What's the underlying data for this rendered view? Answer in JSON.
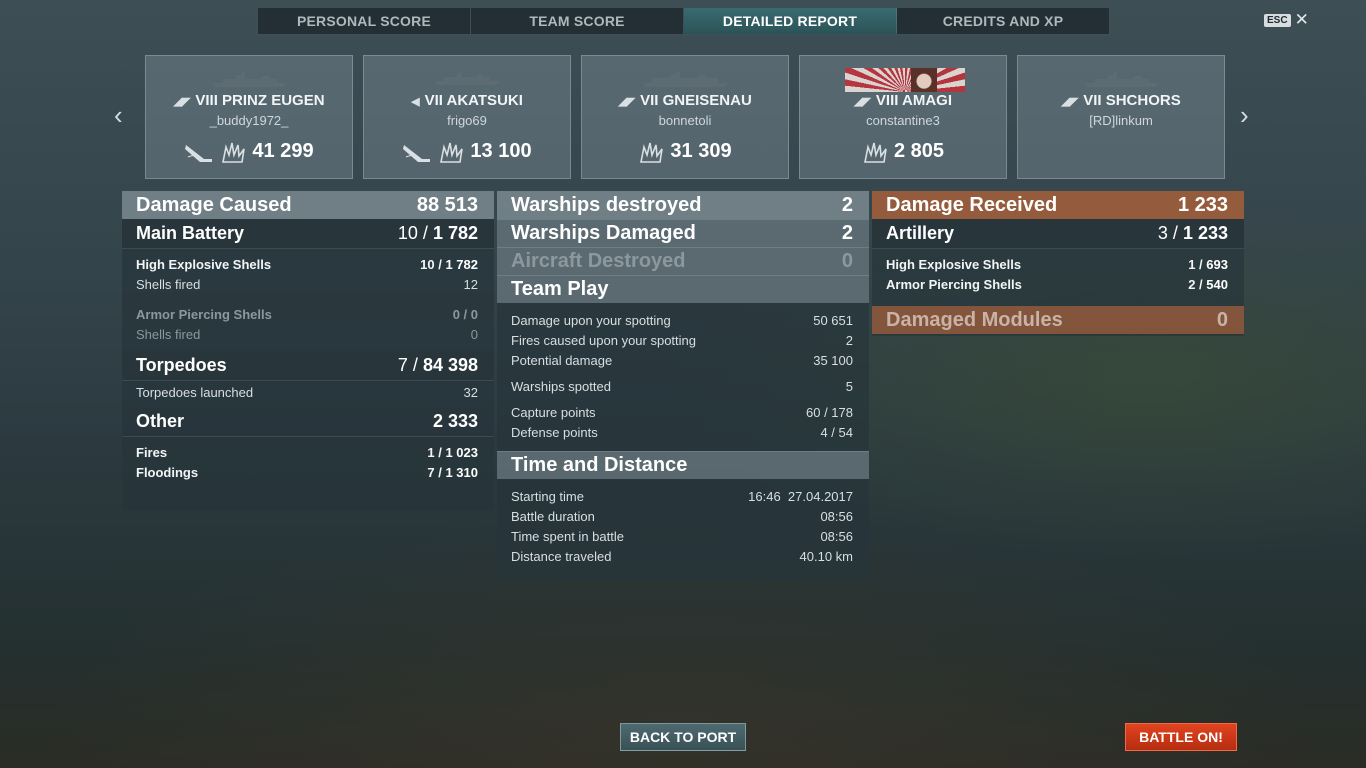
{
  "tabs": [
    "PERSONAL SCORE",
    "TEAM SCORE",
    "DETAILED REPORT",
    "CREDITS AND XP"
  ],
  "esc": {
    "key": "ESC",
    "close": "✕"
  },
  "nav": {
    "prev": "‹",
    "next": "›"
  },
  "cards": [
    {
      "cls": "◢◤",
      "name": "VIII PRINZ EUGEN",
      "player": "_buddy1972_",
      "score": "41 299"
    },
    {
      "cls": "◀",
      "name": "VII AKATSUKI",
      "player": "frigo69",
      "score": "13 100"
    },
    {
      "cls": "◢◤",
      "name": "VII GNEISENAU",
      "player": "bonnetoli",
      "score": "31 309"
    },
    {
      "cls": "◢◤",
      "name": "VIII AMAGI",
      "player": "constantine3",
      "score": "2 805"
    },
    {
      "cls": "◢◤",
      "name": "VII SHCHORS",
      "player": "[RD]linkum",
      "score": ""
    }
  ],
  "left": {
    "damage_caused": {
      "label": "Damage Caused",
      "value": "88 513"
    },
    "main_battery": {
      "label": "Main Battery",
      "hits": "10 /",
      "dmg": "1 782"
    },
    "he": {
      "label": "High Explosive Shells",
      "hits": "10 /",
      "dmg": "1 782"
    },
    "he_fired": {
      "label": "Shells fired",
      "value": "12"
    },
    "ap": {
      "label": "Armor Piercing Shells",
      "value": "0 / 0"
    },
    "ap_fired": {
      "label": "Shells fired",
      "value": "0"
    },
    "torpedoes": {
      "label": "Torpedoes",
      "hits": "7 /",
      "dmg": "84 398"
    },
    "torp_launched": {
      "label": "Torpedoes launched",
      "value": "32"
    },
    "other": {
      "label": "Other",
      "value": "2 333"
    },
    "fires": {
      "label": "Fires",
      "hits": "1 /",
      "dmg": "1 023"
    },
    "floodings": {
      "label": "Floodings",
      "hits": "7 /",
      "dmg": "1 310"
    }
  },
  "middle": {
    "destroyed": {
      "label": "Warships destroyed",
      "value": "2"
    },
    "damaged": {
      "label": "Warships Damaged",
      "value": "2"
    },
    "aircraft": {
      "label": "Aircraft Destroyed",
      "value": "0"
    },
    "team_play": "Team Play",
    "spot_dmg": {
      "label": "Damage upon your spotting",
      "value": "50 651"
    },
    "spot_fires": {
      "label": "Fires caused upon your spotting",
      "value": "2"
    },
    "potential": {
      "label": "Potential damage",
      "value": "35 100"
    },
    "spotted": {
      "label": "Warships spotted",
      "value": "5"
    },
    "capture": {
      "label": "Capture points",
      "value": "60 / 178"
    },
    "defense": {
      "label": "Defense points",
      "value": "4 / 54"
    },
    "time_distance": "Time and Distance",
    "start": {
      "label": "Starting time",
      "value": "16:46  27.04.2017"
    },
    "duration": {
      "label": "Battle duration",
      "value": "08:56"
    },
    "time_spent": {
      "label": "Time spent in battle",
      "value": "08:56"
    },
    "distance": {
      "label": "Distance traveled",
      "value": "40.10 km"
    }
  },
  "right": {
    "received": {
      "label": "Damage Received",
      "value": "1 233"
    },
    "artillery": {
      "label": "Artillery",
      "hits": "3 /",
      "dmg": "1 233"
    },
    "he": {
      "label": "High Explosive Shells",
      "hits": "1 /",
      "dmg": "693"
    },
    "ap": {
      "label": "Armor Piercing Shells",
      "hits": "2 /",
      "dmg": "540"
    },
    "modules": {
      "label": "Damaged Modules",
      "value": "0"
    }
  },
  "buttons": {
    "back": "BACK TO PORT",
    "battle": "BATTLE ON!"
  },
  "colors": {
    "accent_tab": "#2b5357",
    "battle": "#d23a18",
    "received": "#a05f3c"
  }
}
